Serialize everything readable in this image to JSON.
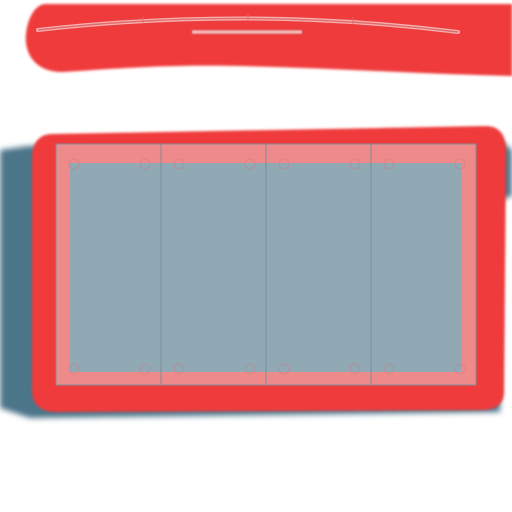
{
  "colors": {
    "background": "#ffffff",
    "highlight_red": "#ef3b3b",
    "panel_slate": "#4b7489",
    "panel_fill": "#90a9b4",
    "frame_pink": "#ef8a8a",
    "divider": "#7d8f98"
  },
  "panel": {
    "columns": 4,
    "mounting_holes_per_column": 4
  }
}
